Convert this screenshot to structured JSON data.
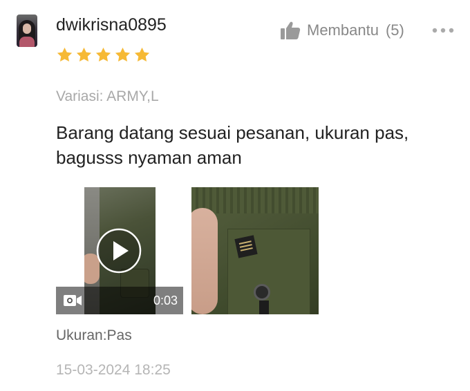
{
  "review": {
    "username": "dwikrisna0895",
    "rating": 5,
    "rating_max": 5,
    "variation": "Variasi: ARMY,L",
    "text": "Barang datang sesuai pesanan, ukuran pas, bagusss nyaman aman",
    "fit": "Ukuran:Pas",
    "timestamp": "15-03-2024 18:25"
  },
  "helpful": {
    "label": "Membantu",
    "count": "(5)"
  },
  "media": {
    "video_duration": "0:03"
  },
  "icons": {
    "avatar": "user-avatar",
    "star": "star-icon",
    "thumb": "thumb-up-icon",
    "more": "more-options-icon",
    "play": "play-icon",
    "camera": "video-camera-icon"
  },
  "colors": {
    "star": "#F6B935",
    "muted": "#888888",
    "light_muted": "#B5B5B5",
    "text": "#222222"
  }
}
